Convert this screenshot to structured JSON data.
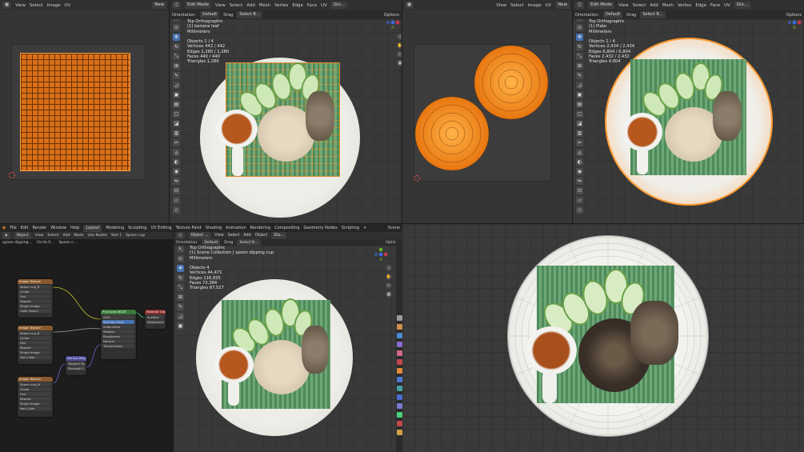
{
  "top_menu": {
    "items": [
      "File",
      "Edit",
      "Render",
      "Window",
      "Help"
    ],
    "workspaces": [
      "Layout",
      "Modeling",
      "Sculpting",
      "UV Editing",
      "Texture Paint",
      "Shading",
      "Animation",
      "Rendering",
      "Compositing",
      "Geometry Nodes",
      "Scripting"
    ],
    "active_workspace": "Layout",
    "scene": "Scene"
  },
  "uv_left": {
    "menu": [
      "View",
      "Select",
      "Image",
      "UV"
    ],
    "new_label": "New",
    "sub_items": [
      "Orientation",
      "Default",
      "Drag",
      "Select B...",
      "Options"
    ]
  },
  "vp_top_mid": {
    "header": [
      "Edit Mode",
      "View",
      "Select",
      "Add",
      "Mesh",
      "Vertex",
      "Edge",
      "Face",
      "UV",
      "Glo..."
    ],
    "overlay": [
      "Top Orthographic",
      "(1) banana leaf",
      "Millimeters",
      "",
      "Objects   1 / 4",
      "Vertices  442 / 442",
      "Edges   1,280 / 1,280",
      "Faces   440 / 440",
      "Triangles  1,280"
    ],
    "subbar": [
      "Orientation:",
      "Default",
      "Drag",
      "Select B...",
      "Options"
    ]
  },
  "uv_right": {
    "menu": [
      "View",
      "Select",
      "Image",
      "UV"
    ],
    "new_label": "New"
  },
  "vp_top_right": {
    "header": [
      "Edit Mode",
      "View",
      "Select",
      "Add",
      "Mesh",
      "Vertex",
      "Edge",
      "Face",
      "UV",
      "Glo..."
    ],
    "overlay": [
      "Top Orthographic",
      "(1) Plate",
      "Millimeters",
      "",
      "Objects   1 / 4",
      "Vertices  2,434 / 2,434",
      "Edges   6,804 / 6,804",
      "Faces   2,432 / 2,432",
      "Triangles  4,804"
    ],
    "subbar": [
      "Orientation:",
      "Default",
      "Drag",
      "Select B...",
      "Options"
    ]
  },
  "node_editor": {
    "header": [
      "Object",
      "View",
      "Select",
      "Add",
      "Node",
      "Use Nodes",
      "Slot 1",
      "Spoon cup"
    ],
    "breadcrumb": [
      "spoon dipping...",
      "Circle.0...",
      "Spoon c..."
    ],
    "nodes": [
      {
        "title": "Image Texture",
        "rows": [
          "Spoon cup_B",
          "Color",
          "Alpha",
          "Linear",
          "Flat",
          "Repeat",
          "Single Image",
          "Color Space",
          "sRGB",
          "Alpha",
          "Straight"
        ]
      },
      {
        "title": "Image Texture",
        "rows": [
          "Spoon cup_R",
          "Linear",
          "Flat",
          "Repeat",
          "Single Image",
          "Color Space",
          "Non-Color",
          "Alpha",
          "Straight"
        ]
      },
      {
        "title": "Image Texture",
        "rows": [
          "Spoon cup_N",
          "Linear",
          "Flat",
          "Repeat",
          "Single Image",
          "Color Space",
          "Non-Color",
          "Alpha",
          "Straight"
        ]
      },
      {
        "title": "Normal Map",
        "rows": [
          "Normal",
          "Tangent Space",
          "UVMap",
          "Strength 1.000",
          "Color"
        ]
      },
      {
        "title": "Principled BSDF",
        "rows": [
          "BSDF",
          "GGX",
          "Random Walk",
          "Base Color",
          "Subsurface",
          "Subsurface Radius",
          "Metallic",
          "Specular",
          "Roughness",
          "IOR",
          "Alpha",
          "Normal",
          "Emission",
          "Clearcoat",
          "Sheen",
          "Transmission"
        ]
      },
      {
        "title": "Material Output",
        "rows": [
          "All",
          "Surface",
          "Volume",
          "Displacement"
        ]
      }
    ]
  },
  "vp_bottom_mid": {
    "header": [
      "Object ...",
      "View",
      "Select",
      "Add",
      "Object",
      "Glo..."
    ],
    "overlay": [
      "Top Orthographic",
      "(1) Scene Collection | spoon dipping cup",
      "Millimeters",
      "",
      "Objects   4",
      "Vertices  44,471",
      "Edges   116,835",
      "Faces   72,384",
      "Triangles  87,527"
    ],
    "subbar": [
      "Orientation:",
      "Default",
      "Drag",
      "Select B...",
      "Options"
    ]
  },
  "colors": {
    "accent": "#4772b3",
    "selection": "#f28a1c",
    "viewport": "#3b3b3b",
    "header": "#303030"
  }
}
